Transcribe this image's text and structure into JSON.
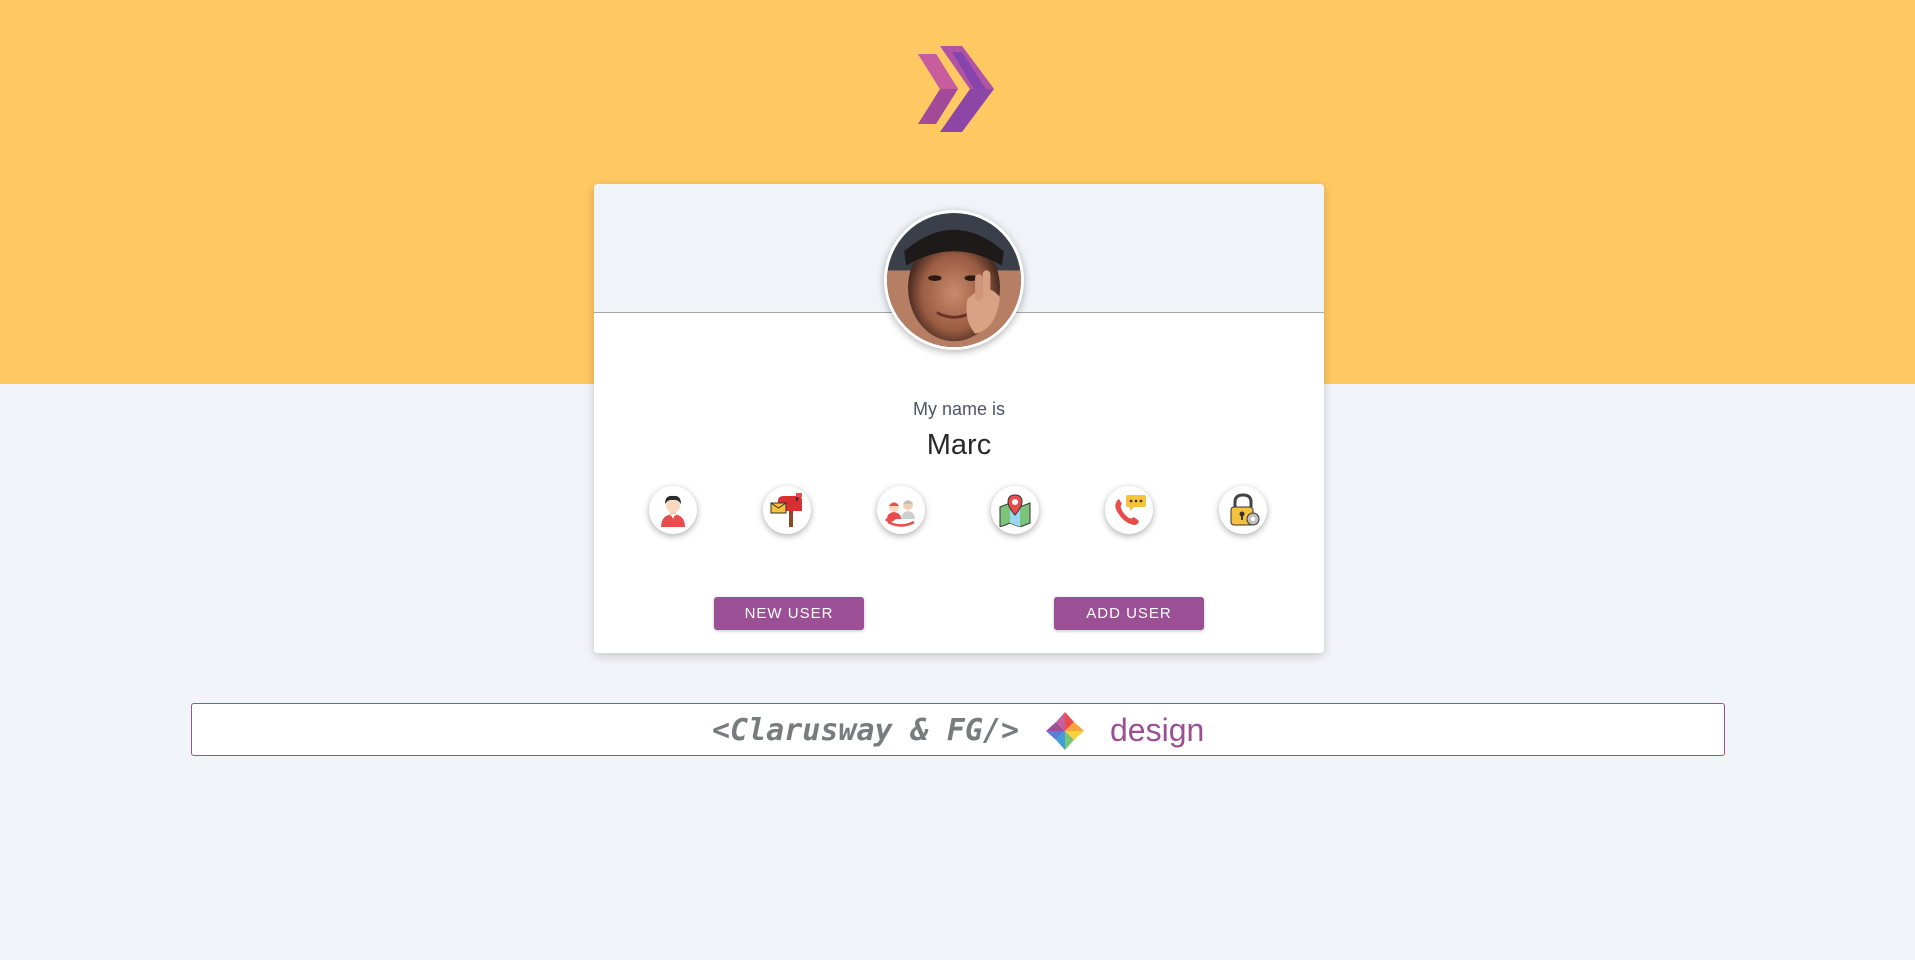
{
  "profile": {
    "intro_label": "My name is",
    "name": "Marc"
  },
  "icons": [
    {
      "name": "user-icon"
    },
    {
      "name": "mailbox-icon"
    },
    {
      "name": "age-icon"
    },
    {
      "name": "map-location-icon"
    },
    {
      "name": "phone-icon"
    },
    {
      "name": "lock-icon"
    }
  ],
  "buttons": {
    "new_user": "NEW USER",
    "add_user": "ADD USER"
  },
  "footer": {
    "code_text": "<Clarusway & FG/>",
    "design_text": "design"
  },
  "colors": {
    "top_band": "#fec862",
    "accent": "#9b4f94",
    "background": "#f1f4f8"
  }
}
